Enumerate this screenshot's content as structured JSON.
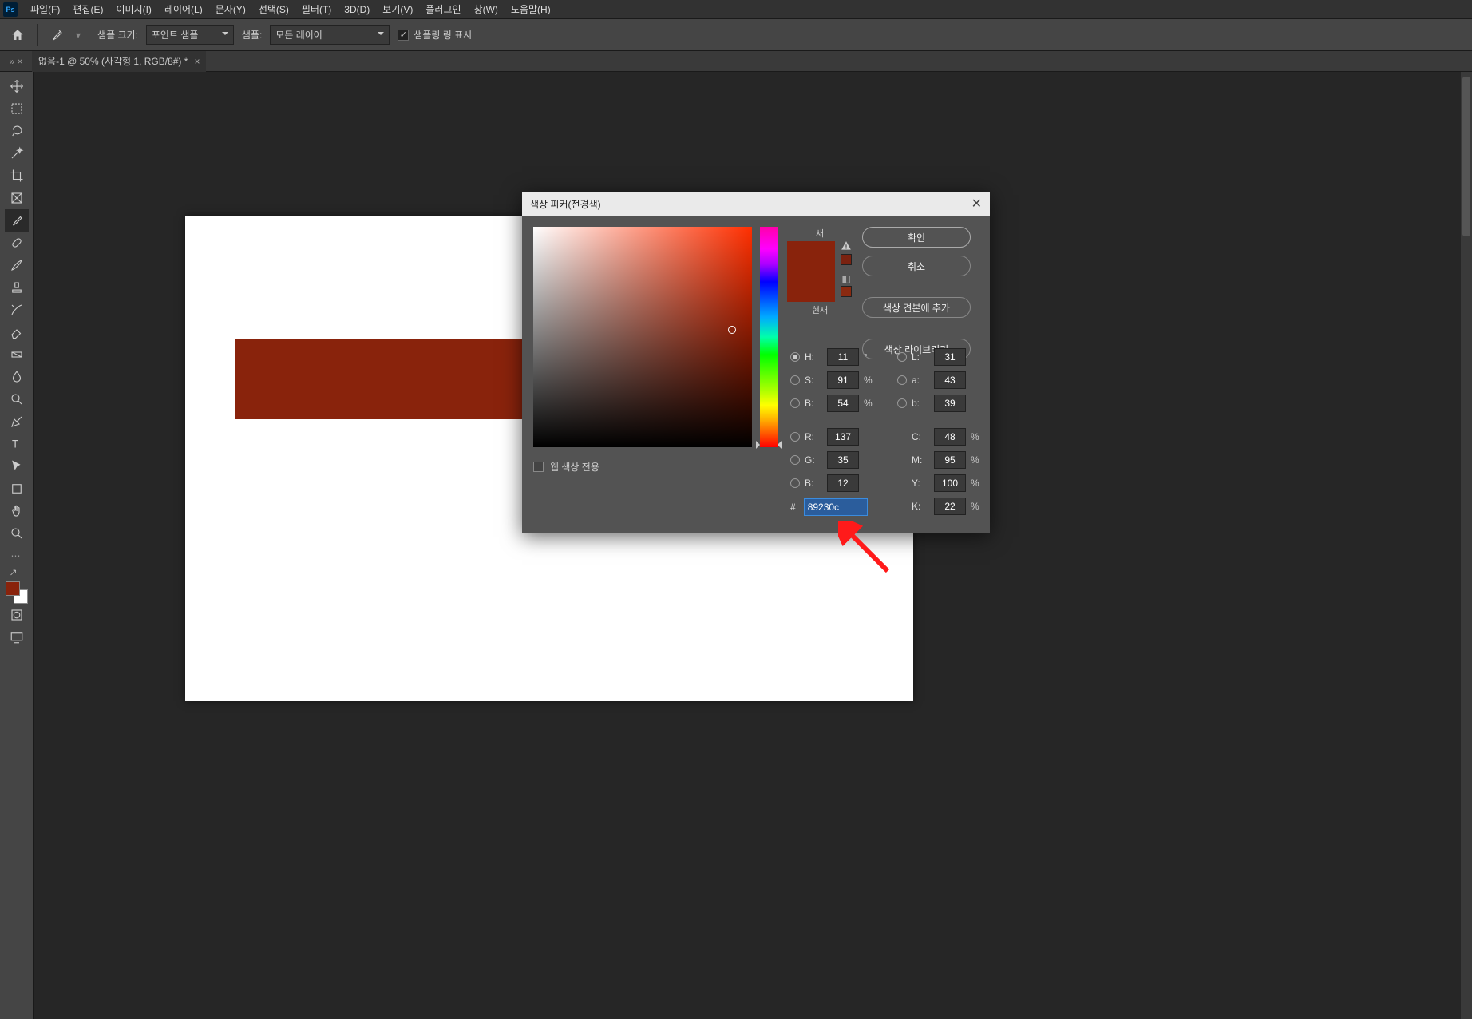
{
  "menubar": {
    "items": [
      "파일(F)",
      "편집(E)",
      "이미지(I)",
      "레이어(L)",
      "문자(Y)",
      "선택(S)",
      "필터(T)",
      "3D(D)",
      "보기(V)",
      "플러그인",
      "창(W)",
      "도움말(H)"
    ]
  },
  "optionsbar": {
    "sample_size_label": "샘플 크기:",
    "sample_size_value": "포인트 샘플",
    "sample_label": "샘플:",
    "sample_value": "모든 레이어",
    "show_sampling_ring": "샘플링 링 표시"
  },
  "doc_tab": {
    "title": "없음-1 @ 50% (사각형 1, RGB/8#) *"
  },
  "color_picker": {
    "title": "색상 피커(전경색)",
    "ok": "확인",
    "cancel": "취소",
    "add_swatch": "색상 견본에 추가",
    "color_libraries": "색상 라이브러리",
    "new_label": "새",
    "current_label": "현재",
    "web_only": "웹 색상 전용",
    "hsb": {
      "H": "11",
      "S": "91",
      "B": "54",
      "H_unit": "°",
      "SB_unit": "%"
    },
    "lab": {
      "L": "31",
      "a": "43",
      "b": "39"
    },
    "rgb": {
      "R": "137",
      "G": "35",
      "B": "12"
    },
    "cmyk": {
      "C": "48",
      "M": "95",
      "Y": "100",
      "K": "22",
      "unit": "%"
    },
    "hex_label": "#",
    "hex_value": "89230c",
    "labels": {
      "H": "H:",
      "S": "S:",
      "B": "B:",
      "R": "R:",
      "G": "G:",
      "BB": "B:",
      "L": "L:",
      "a": "a:",
      "bb": "b:",
      "C": "C:",
      "M": "M:",
      "Y": "Y:",
      "K": "K:"
    }
  },
  "swatch_color": "#89230c"
}
